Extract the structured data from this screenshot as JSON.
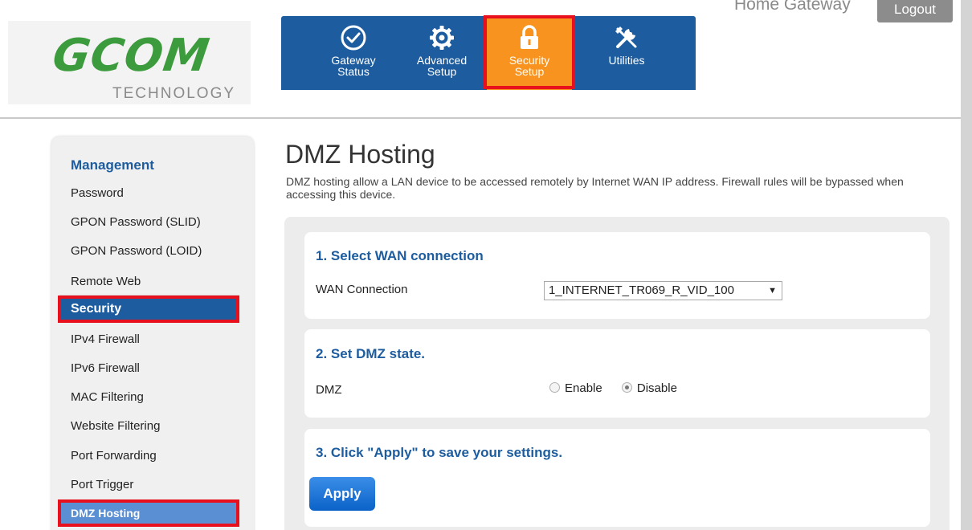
{
  "brand": {
    "logo_text": "GCOM",
    "logo_subtext": "TECHNOLOGY"
  },
  "header": {
    "home_gateway": "Home Gateway",
    "logout_label": "Logout"
  },
  "nav": [
    {
      "label": "Gateway\nStatus",
      "icon": "check-circle-icon"
    },
    {
      "label": "Advanced\nSetup",
      "icon": "gear-icon"
    },
    {
      "label": "Security\nSetup",
      "icon": "lock-icon",
      "active": true
    },
    {
      "label": "Utilities",
      "icon": "tools-icon"
    }
  ],
  "sidebar": {
    "management_heading": "Management",
    "management_items": [
      "Password",
      "GPON Password (SLID)",
      "GPON Password (LOID)",
      "Remote Web"
    ],
    "security_heading": "Security",
    "security_items": [
      "IPv4 Firewall",
      "IPv6 Firewall",
      "MAC Filtering",
      "Website Filtering",
      "Port Forwarding",
      "Port Trigger"
    ],
    "active_item": "DMZ Hosting"
  },
  "page": {
    "title": "DMZ Hosting",
    "description": "DMZ hosting allow a LAN device to be accessed remotely by Internet WAN IP address. Firewall rules will be bypassed when accessing this device."
  },
  "section1": {
    "title": "1. Select WAN connection",
    "label": "WAN Connection",
    "selected": "1_INTERNET_TR069_R_VID_100"
  },
  "section2": {
    "title": "2. Set DMZ state.",
    "label": "DMZ",
    "options": [
      "Enable",
      "Disable"
    ],
    "selected": "Disable"
  },
  "section3": {
    "title": "3. Click \"Apply\" to save your settings.",
    "apply_label": "Apply"
  },
  "colors": {
    "nav_blue": "#1d5c9e",
    "nav_active_orange": "#f7931e",
    "highlight_red": "#e8101c",
    "logo_green": "#3c9b3c",
    "sidebar_active": "#5b8fd4"
  }
}
